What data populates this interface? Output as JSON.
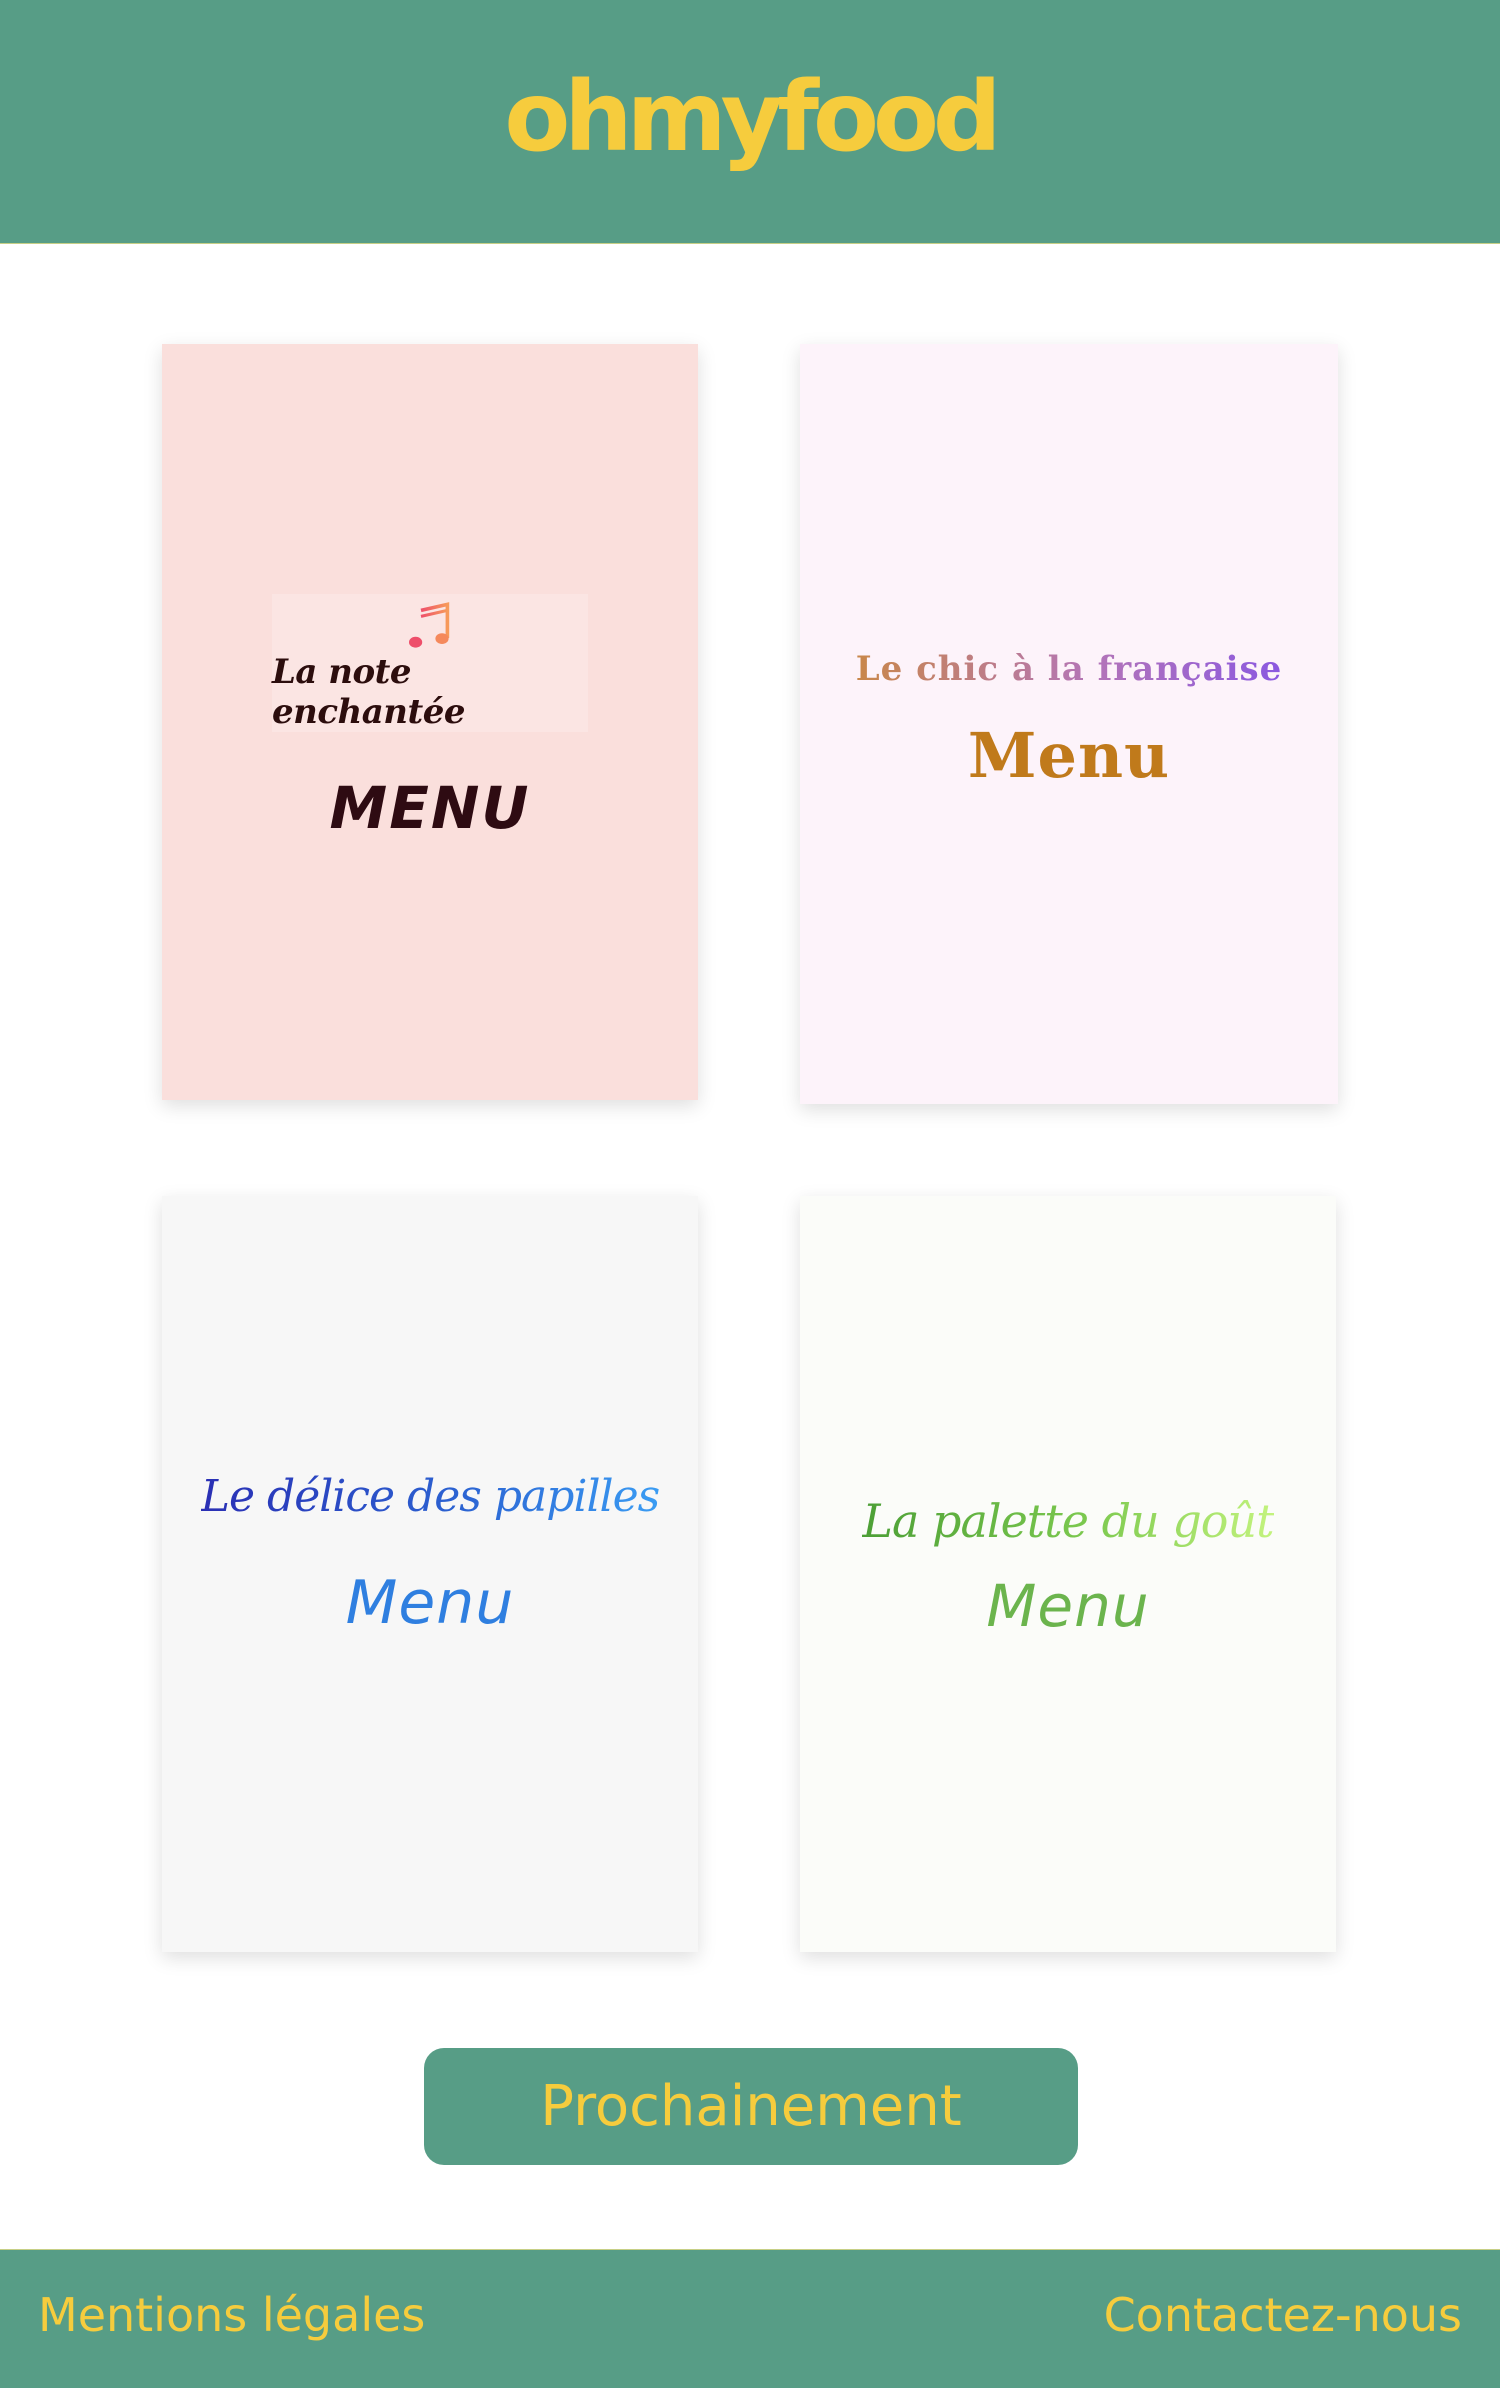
{
  "header": {
    "logo": "ohmyfood"
  },
  "restaurants": [
    {
      "name": "La note enchantée",
      "menu_label": "MENU",
      "icon": "music-note-icon"
    },
    {
      "name": "Le chic à la française",
      "menu_label": "Menu"
    },
    {
      "name": "Le délice des papilles",
      "menu_label": "Menu"
    },
    {
      "name": "La palette du goût",
      "menu_label": "Menu"
    }
  ],
  "actions": {
    "coming_soon_label": "Prochainement"
  },
  "footer": {
    "legal_label": "Mentions légales",
    "contact_label": "Contactez-nous"
  },
  "colors": {
    "brand_green": "#579d86",
    "brand_yellow": "#f6cc3d"
  }
}
